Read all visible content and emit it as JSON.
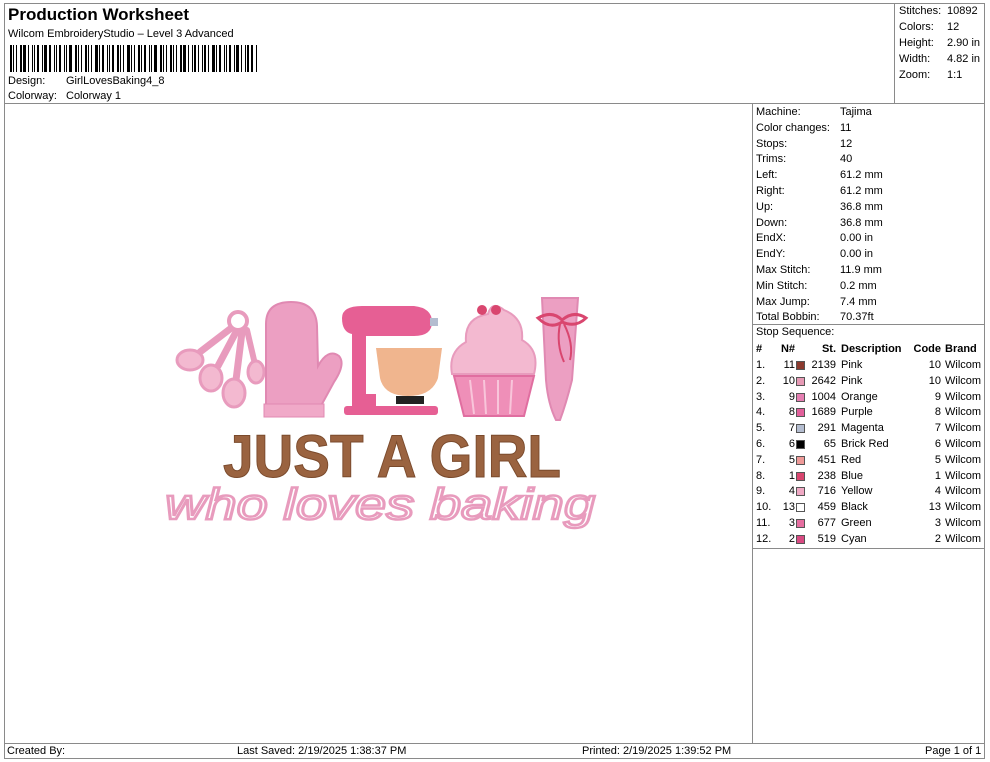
{
  "header": {
    "title": "Production Worksheet",
    "subtitle": "Wilcom EmbroideryStudio – Level 3 Advanced",
    "design_label": "Design:",
    "design_value": "GirlLovesBaking4_8",
    "colorway_label": "Colorway:",
    "colorway_value": "Colorway 1"
  },
  "summary": [
    {
      "k": "Stitches:",
      "v": "10892"
    },
    {
      "k": "Colors:",
      "v": "12"
    },
    {
      "k": "Height:",
      "v": "2.90 in"
    },
    {
      "k": "Width:",
      "v": "4.82 in"
    },
    {
      "k": "Zoom:",
      "v": "1:1"
    }
  ],
  "machine_info": [
    {
      "k": "Machine:",
      "v": "Tajima"
    },
    {
      "k": "Color changes:",
      "v": "11"
    },
    {
      "k": "Stops:",
      "v": "12"
    },
    {
      "k": "Trims:",
      "v": "40"
    },
    {
      "k": "Left:",
      "v": "61.2 mm"
    },
    {
      "k": "Right:",
      "v": "61.2 mm"
    },
    {
      "k": "Up:",
      "v": "36.8 mm"
    },
    {
      "k": "Down:",
      "v": "36.8 mm"
    },
    {
      "k": "EndX:",
      "v": "0.00 in"
    },
    {
      "k": "EndY:",
      "v": "0.00 in"
    },
    {
      "k": "Max Stitch:",
      "v": "11.9 mm"
    },
    {
      "k": "Min Stitch:",
      "v": "0.2 mm"
    },
    {
      "k": "Max Jump:",
      "v": "7.4 mm"
    },
    {
      "k": "Total Bobbin:",
      "v": "70.37ft"
    }
  ],
  "stop_sequence": {
    "label": "Stop Sequence:",
    "headers": {
      "idx": "#",
      "n": "N#",
      "st": "St.",
      "desc": "Description",
      "code": "Code",
      "brand": "Brand"
    },
    "rows": [
      {
        "idx": "1.",
        "n": "11",
        "color": "#8b3a2e",
        "st": "2139",
        "desc": "Pink",
        "code": "10",
        "brand": "Wilcom"
      },
      {
        "idx": "2.",
        "n": "10",
        "color": "#e79ab5",
        "st": "2642",
        "desc": "Pink",
        "code": "10",
        "brand": "Wilcom"
      },
      {
        "idx": "3.",
        "n": "9",
        "color": "#e57fb2",
        "st": "1004",
        "desc": "Orange",
        "code": "9",
        "brand": "Wilcom"
      },
      {
        "idx": "4.",
        "n": "8",
        "color": "#e2609b",
        "st": "1689",
        "desc": "Purple",
        "code": "8",
        "brand": "Wilcom"
      },
      {
        "idx": "5.",
        "n": "7",
        "color": "#b4bdd0",
        "st": "291",
        "desc": "Magenta",
        "code": "7",
        "brand": "Wilcom"
      },
      {
        "idx": "6.",
        "n": "6",
        "color": "#000000",
        "st": "65",
        "desc": "Brick Red",
        "code": "6",
        "brand": "Wilcom"
      },
      {
        "idx": "7.",
        "n": "5",
        "color": "#ef9a98",
        "st": "451",
        "desc": "Red",
        "code": "5",
        "brand": "Wilcom"
      },
      {
        "idx": "8.",
        "n": "1",
        "color": "#d9466f",
        "st": "238",
        "desc": "Blue",
        "code": "1",
        "brand": "Wilcom"
      },
      {
        "idx": "9.",
        "n": "4",
        "color": "#f0a9c4",
        "st": "716",
        "desc": "Yellow",
        "code": "4",
        "brand": "Wilcom"
      },
      {
        "idx": "10.",
        "n": "13",
        "color": "#ffffff",
        "st": "459",
        "desc": "Black",
        "code": "13",
        "brand": "Wilcom"
      },
      {
        "idx": "11.",
        "n": "3",
        "color": "#e66ea0",
        "st": "677",
        "desc": "Green",
        "code": "3",
        "brand": "Wilcom"
      },
      {
        "idx": "12.",
        "n": "2",
        "color": "#d94a82",
        "st": "519",
        "desc": "Cyan",
        "code": "2",
        "brand": "Wilcom"
      }
    ]
  },
  "design_preview": {
    "headline": "JUST A GIRL",
    "script_line": "who loves baking",
    "colors": {
      "brown": "#9a6340",
      "pink": "#e89bbd",
      "light_pink": "#f3b9d0",
      "peach": "#f0b58e"
    }
  },
  "footer": {
    "created_by": "Created By:",
    "last_saved": "Last Saved: 2/19/2025 1:38:37 PM",
    "printed": "Printed: 2/19/2025 1:39:52 PM",
    "page": "Page 1 of 1"
  }
}
